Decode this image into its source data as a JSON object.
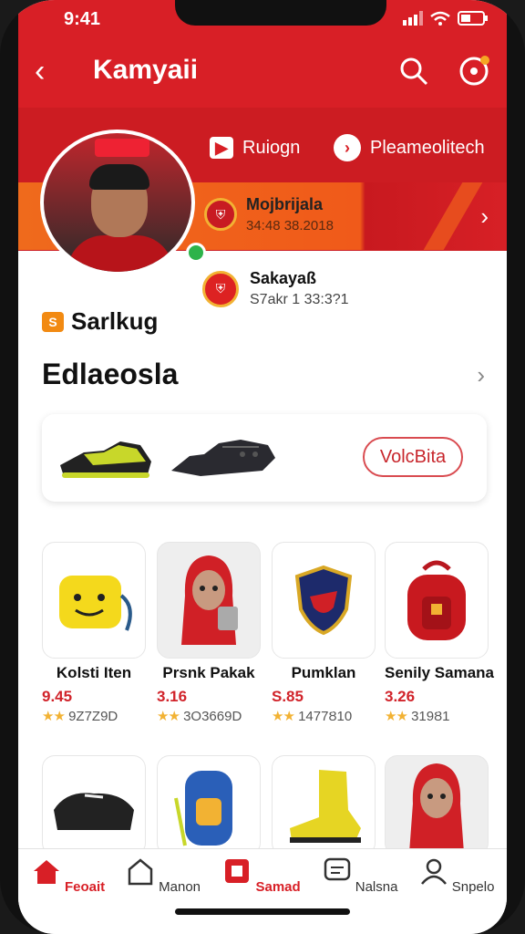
{
  "status": {
    "time": "9:41"
  },
  "appbar": {
    "title": "Kamyaii"
  },
  "header": {
    "btn_left": "Ruiogn",
    "btn_right": "Pleameolitech"
  },
  "match1": {
    "team": "Mojbrijala",
    "time": "34:48 38.2018"
  },
  "match2": {
    "team": "Sakayaß",
    "time": "S7akr 1 33:3?1"
  },
  "brand": {
    "name": "Sarlkug"
  },
  "section": {
    "title": "Edlaeosla"
  },
  "shoe_card": {
    "button": "VolcBita"
  },
  "items": [
    {
      "name": "Kolsti Iten",
      "price": "9.45",
      "stars": "★★",
      "rating": "9Z7Z9D"
    },
    {
      "name": "Prsnk Pakak",
      "price": "3.16",
      "stars": "★★",
      "rating": "3O3669D"
    },
    {
      "name": "Pumklan",
      "price": "S.85",
      "stars": "★★",
      "rating": "1477Ȣ10"
    },
    {
      "name": "Senily Samana",
      "price": "3.26",
      "stars": "★★",
      "rating": "319Ȣ1"
    }
  ],
  "tabs": [
    {
      "label": "Feoait",
      "active": true
    },
    {
      "label": "Manon",
      "active": false
    },
    {
      "label": "Samad",
      "active": true
    },
    {
      "label": "Nalsna",
      "active": false
    },
    {
      "label": "Snpelo",
      "active": false
    }
  ],
  "colors": {
    "brand_red": "#d81f26",
    "accent_orange": "#ef6a1c",
    "star": "#f2b233"
  }
}
